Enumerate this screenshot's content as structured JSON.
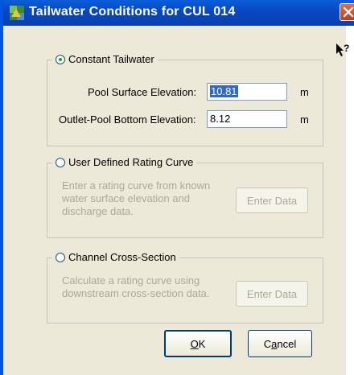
{
  "window": {
    "title": "Tailwater Conditions for CUL 014",
    "close_icon": "close-x-icon",
    "help_icon": "context-help-icon"
  },
  "constant": {
    "label": "Constant Tailwater",
    "selected": true,
    "pool_label": "Pool Surface Elevation:",
    "pool_value": "10.81",
    "pool_unit": "m",
    "outlet_label": "Outlet-Pool Bottom Elevation:",
    "outlet_value": "8.12",
    "outlet_unit": "m"
  },
  "rating": {
    "label": "User Defined Rating Curve",
    "selected": false,
    "description": "Enter a rating curve from known water surface elevation and discharge data.",
    "button": "Enter Data"
  },
  "channel": {
    "label": "Channel Cross-Section",
    "selected": false,
    "description": "Calculate a rating curve using downstream cross-section data.",
    "button": "Enter Data"
  },
  "footer": {
    "ok_mnemonic": "O",
    "ok_rest": "K",
    "cancel_pre": "C",
    "cancel_mnemonic": "a",
    "cancel_rest": "ncel"
  }
}
